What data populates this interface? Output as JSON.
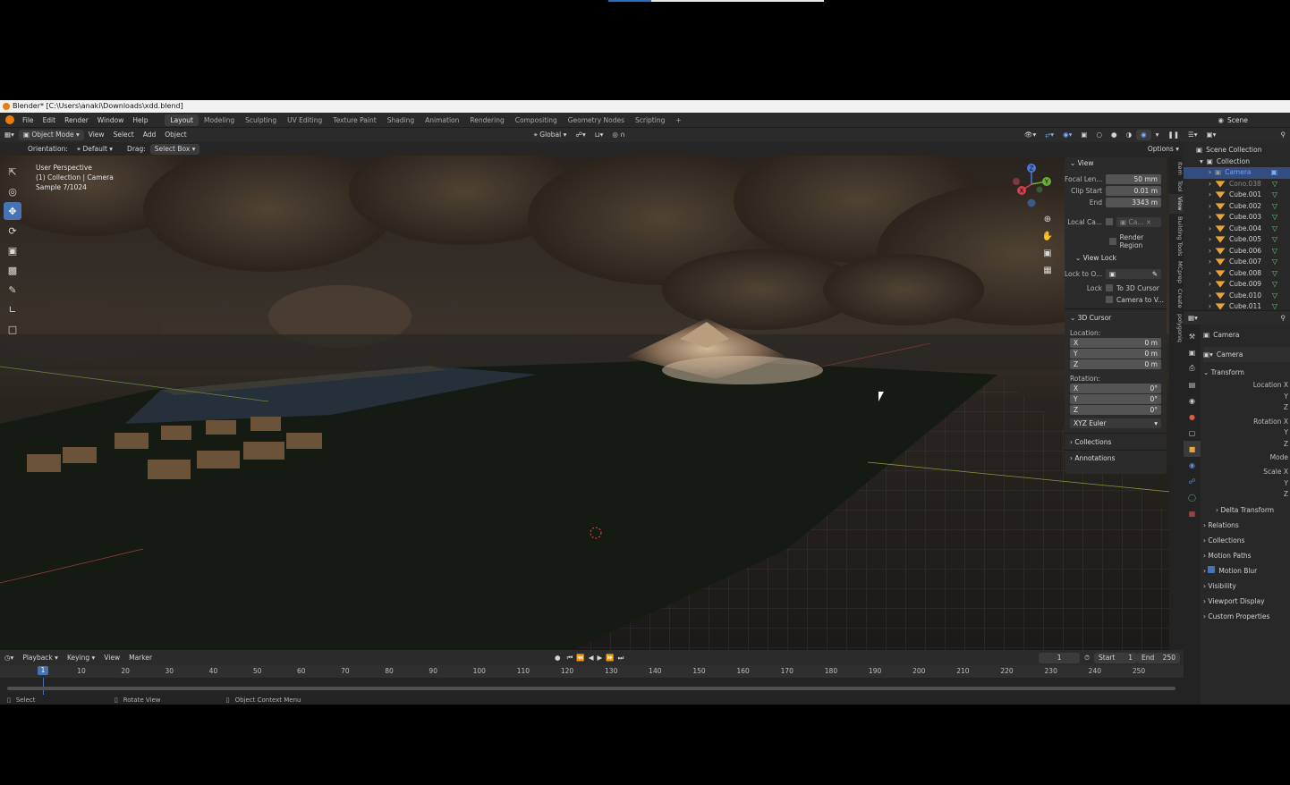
{
  "window": {
    "title": "Blender* [C:\\Users\\anaki\\Downloads\\xdd.blend]"
  },
  "menu": [
    "File",
    "Edit",
    "Render",
    "Window",
    "Help"
  ],
  "workspaces": [
    "Layout",
    "Modeling",
    "Sculpting",
    "UV Editing",
    "Texture Paint",
    "Shading",
    "Animation",
    "Rendering",
    "Compositing",
    "Geometry Nodes",
    "Scripting"
  ],
  "scene_field": "Scene",
  "header3d": {
    "mode": "Object Mode",
    "view": "View",
    "select": "Select",
    "add": "Add",
    "object": "Object",
    "transform": "Global"
  },
  "toolsettings": {
    "orientation_label": "Orientation:",
    "orientation": "Default",
    "drag_label": "Drag:",
    "drag": "Select Box",
    "options": "Options"
  },
  "viewport": {
    "line1": "User Perspective",
    "line2": "(1) Collection | Camera",
    "line3": "Sample 7/1024"
  },
  "gizmo": {
    "x": "X",
    "y": "Y",
    "z": "Z"
  },
  "npanel": {
    "view_header": "View",
    "focal_label": "Focal Len...",
    "focal": "50 mm",
    "clip_start_label": "Clip Start",
    "clip_start": "0.01 m",
    "clip_end_label": "End",
    "clip_end": "3343 m",
    "local_camera_label": "Local Ca...",
    "local_camera_value": "Ca...",
    "render_region": "Render Region",
    "view_lock_header": "View Lock",
    "lock_to_label": "Lock to O...",
    "lock_label": "Lock",
    "to_3d_cursor": "To 3D Cursor",
    "camera_to_view": "Camera to V...",
    "cursor_header": "3D Cursor",
    "location_label": "Location:",
    "loc": [
      {
        "axis": "X",
        "value": "0 m"
      },
      {
        "axis": "Y",
        "value": "0 m"
      },
      {
        "axis": "Z",
        "value": "0 m"
      }
    ],
    "rotation_label": "Rotation:",
    "rot": [
      {
        "axis": "X",
        "value": "0°"
      },
      {
        "axis": "Y",
        "value": "0°"
      },
      {
        "axis": "Z",
        "value": "0°"
      }
    ],
    "rotation_mode": "XYZ Euler",
    "collections": "Collections",
    "annotations": "Annotations"
  },
  "ntabs": [
    "Item",
    "Tool",
    "View",
    "Building Tools",
    "MCprep",
    "Create",
    "polygoniq"
  ],
  "timeline": {
    "playback": "Playback",
    "keying": "Keying",
    "view": "View",
    "marker": "Marker",
    "current_frame": "1",
    "start_label": "Start",
    "start": "1",
    "end_label": "End",
    "end": "250",
    "ticks": [
      "10",
      "20",
      "30",
      "40",
      "50",
      "60",
      "70",
      "80",
      "90",
      "100",
      "110",
      "120",
      "130",
      "140",
      "150",
      "160",
      "170",
      "180",
      "190",
      "200",
      "210",
      "220",
      "230",
      "240",
      "250"
    ]
  },
  "status": {
    "select": "Select",
    "rotate": "Rotate View",
    "context": "Object Context Menu"
  },
  "outliner": {
    "scene_collection": "Scene Collection",
    "collection": "Collection",
    "items": [
      "Camera",
      "Cono.038",
      "Cube.001",
      "Cube.002",
      "Cube.003",
      "Cube.004",
      "Cube.005",
      "Cube.006",
      "Cube.007",
      "Cube.008",
      "Cube.009",
      "Cube.010",
      "Cube.011"
    ]
  },
  "properties": {
    "object_name": "Camera",
    "object_field": "Camera",
    "transform": "Transform",
    "location_x": "Location X",
    "y": "Y",
    "z": "Z",
    "rotation_x": "Rotation X",
    "mode": "Mode",
    "scale_x": "Scale X",
    "delta": "Delta Transform",
    "relations": "Relations",
    "collections": "Collections",
    "motion_paths": "Motion Paths",
    "motion_blur": "Motion Blur",
    "visibility": "Visibility",
    "viewport_display": "Viewport Display",
    "custom_properties": "Custom Properties"
  }
}
